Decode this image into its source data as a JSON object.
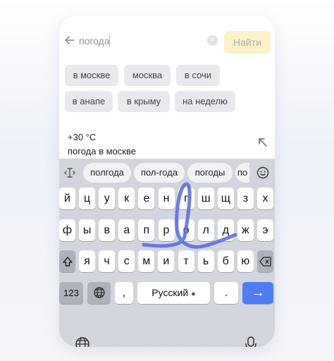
{
  "search": {
    "query": "погода",
    "find_label": "Найти",
    "clear_glyph": "✕"
  },
  "chips": [
    {
      "label": "в москве"
    },
    {
      "label": "москва"
    },
    {
      "label": "в сочи"
    },
    {
      "label": "в анапе"
    },
    {
      "label": "в крыму"
    },
    {
      "label": "на неделю"
    }
  ],
  "answer": {
    "title": "+30 °C",
    "subtitle": "погода в москве"
  },
  "keyboard": {
    "suggestions": [
      "полгода",
      "пол-года",
      "погоды",
      "по"
    ],
    "row1": [
      "й",
      "ц",
      "у",
      "к",
      "е",
      "н",
      "г",
      "ш",
      "щ",
      "з",
      "х"
    ],
    "row2": [
      "ф",
      "ы",
      "в",
      "а",
      "п",
      "р",
      "о",
      "л",
      "д",
      "ж",
      "э"
    ],
    "row3": [
      "я",
      "ч",
      "с",
      "м",
      "и",
      "т",
      "ь",
      "б",
      "ю"
    ],
    "numbers_label": "123",
    "comma": ",",
    "period": ".",
    "space_label": "Русский",
    "enter_glyph": "→",
    "swipe_color": "#5a6fe6",
    "enter_color": "#4c7df5"
  }
}
